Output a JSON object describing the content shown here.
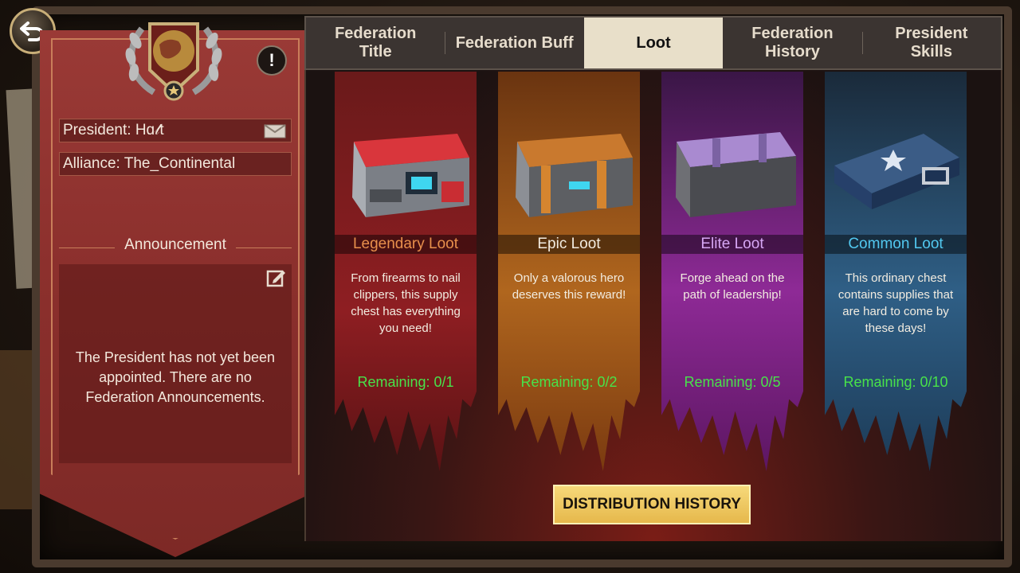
{
  "tabs": [
    {
      "label": "Federation\nTitle"
    },
    {
      "label": "Federation Buff"
    },
    {
      "label": "Loot",
      "active": true
    },
    {
      "label": "Federation\nHistory"
    },
    {
      "label": "President\nSkills"
    }
  ],
  "federation": {
    "president": "President: Hɑ𝓁t",
    "alliance": "Alliance: The_Continental",
    "announcement_title": "Announcement",
    "announcement_text": "The President has not yet been appointed. There are no Federation Announcements."
  },
  "loot": [
    {
      "name": "Legendary Loot",
      "color": "#e88f4c",
      "description": "From firearms to nail clippers, this supply chest has everything you need!",
      "remaining": "Remaining: 0/1"
    },
    {
      "name": "Epic Loot",
      "color": "#f3ece0",
      "description": "Only a valorous hero deserves this reward!",
      "remaining": "Remaining: 0/2"
    },
    {
      "name": "Elite Loot",
      "color": "#d7a7f5",
      "description": "Forge ahead on the path of leadership!",
      "remaining": "Remaining: 0/5"
    },
    {
      "name": "Common Loot",
      "color": "#52c8f0",
      "description": "This ordinary chest contains supplies that are hard to come by these days!",
      "remaining": "Remaining: 0/10"
    }
  ],
  "distribution_button": "DISTRIBUTION HISTORY",
  "colors": {
    "banner_red": "#8c302d",
    "remaining_green": "#48e24a",
    "button_gold": "#e6b84c"
  }
}
